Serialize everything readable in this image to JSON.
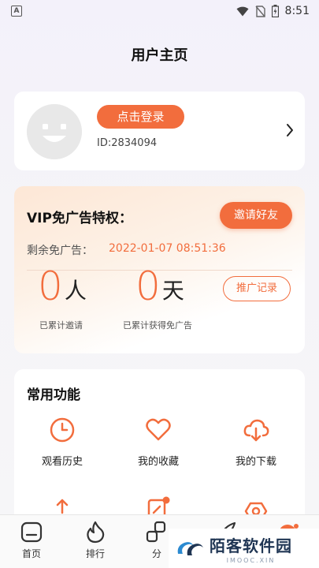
{
  "status_bar": {
    "app_icon": "A",
    "time": "8:51"
  },
  "header": {
    "title": "用户主页"
  },
  "profile": {
    "login_label": "点击登录",
    "user_id": "ID:2834094"
  },
  "vip": {
    "title": "VIP免广告特权：",
    "invite_label": "邀请好友",
    "remaining_label": "剩余免广告：",
    "remaining_value": "2022-01-07 08:51:36",
    "invited_count": "0",
    "invited_unit": "人",
    "invited_caption": "已累计邀请",
    "days_count": "0",
    "days_unit": "天",
    "days_caption": "已累计获得免广告",
    "record_label": "推广记录"
  },
  "functions": {
    "title": "常用功能",
    "items": [
      {
        "label": "观看历史",
        "icon": "clock-icon"
      },
      {
        "label": "我的收藏",
        "icon": "heart-icon"
      },
      {
        "label": "我的下载",
        "icon": "cloud-download-icon"
      }
    ]
  },
  "bottom_nav": {
    "items": [
      {
        "label": "首页",
        "icon": "home-icon"
      },
      {
        "label": "排行",
        "icon": "flame-icon"
      },
      {
        "label": "分",
        "icon": "category-icon"
      }
    ]
  },
  "watermark": {
    "title": "陌客软件园",
    "subtitle": "IMOOC.XIN"
  },
  "colors": {
    "accent": "#f26d3d",
    "text": "#222222",
    "background": "#f5f4f8"
  }
}
